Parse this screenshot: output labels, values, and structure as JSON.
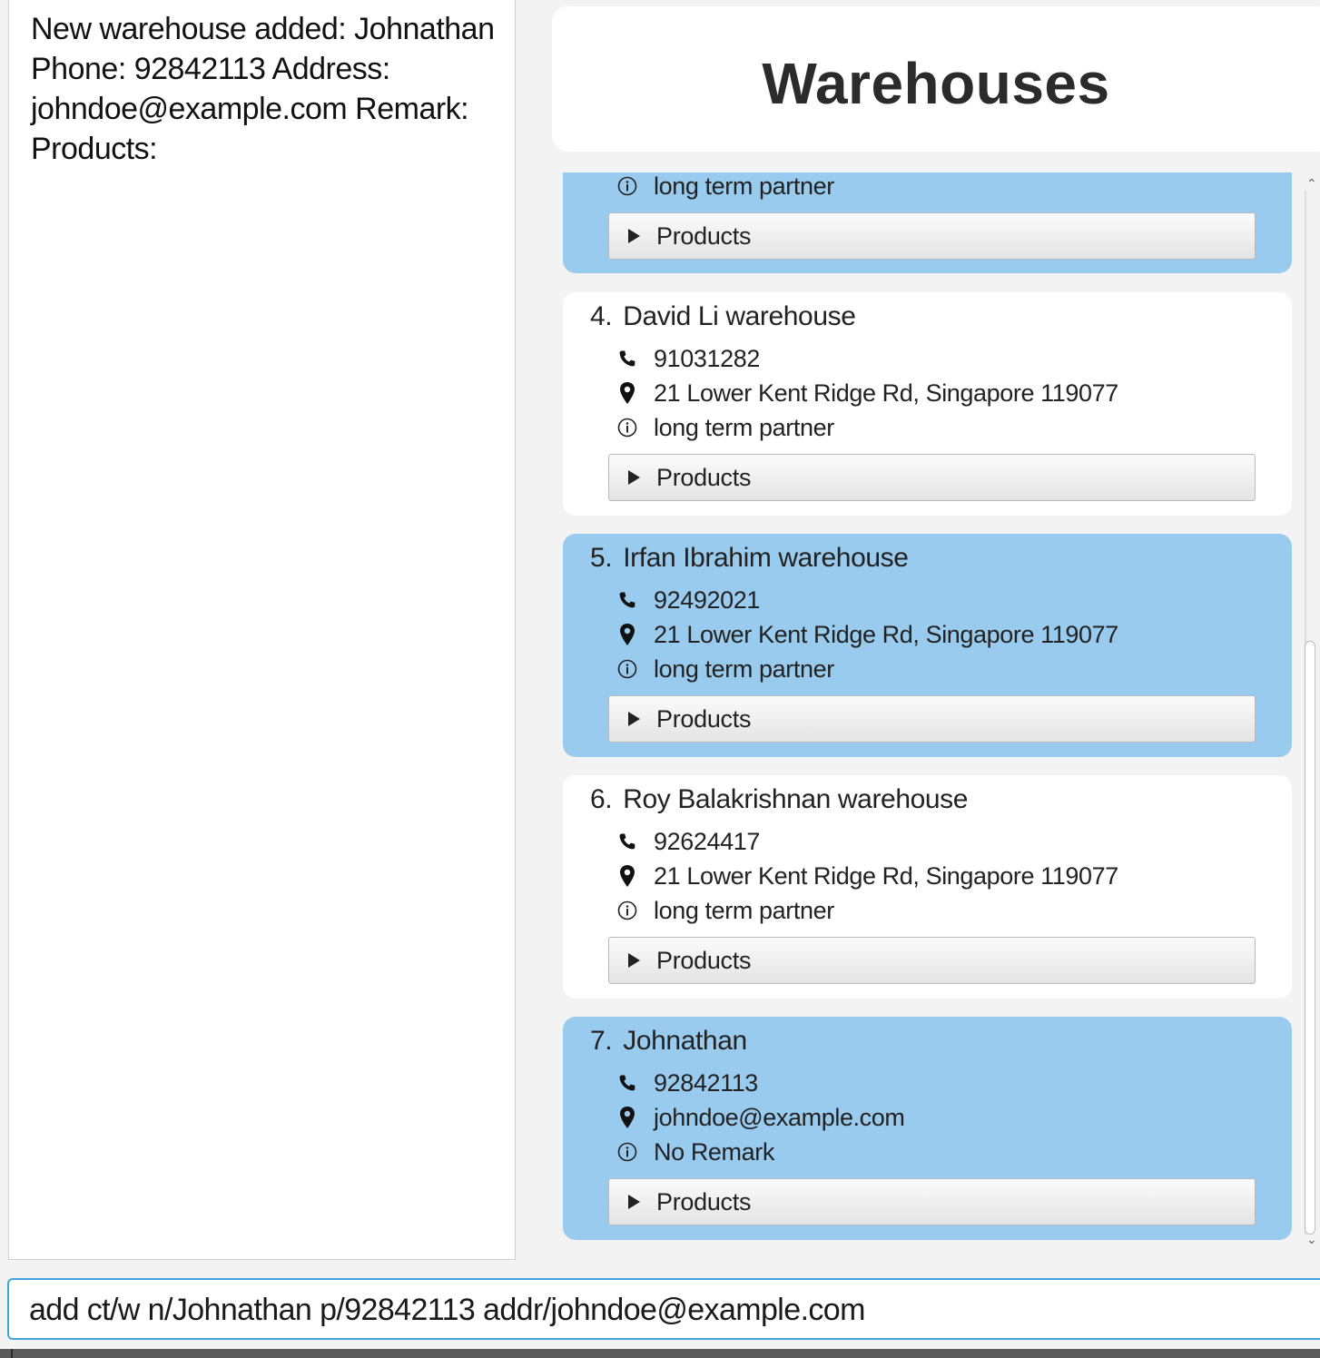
{
  "result_display": {
    "text": "New warehouse added: Johnathan Phone: 92842113 Address: johndoe@example.com Remark: Products:"
  },
  "header": {
    "title": "Warehouses"
  },
  "icons": {
    "phone": "phone-icon",
    "address": "location-pin-icon",
    "remark": "info-icon",
    "expand": "triangle-right-icon"
  },
  "colors": {
    "selected_card": "#99cbee",
    "card": "#ffffff",
    "input_focus_border": "#3ea6dd"
  },
  "warehouses": [
    {
      "remark": "long term partner",
      "products_label": "Products"
    },
    {
      "index": "4.",
      "name": "David Li warehouse",
      "phone": "91031282",
      "address": "21 Lower Kent Ridge Rd, Singapore 119077",
      "remark": "long term partner",
      "products_label": "Products"
    },
    {
      "index": "5.",
      "name": "Irfan Ibrahim warehouse",
      "phone": "92492021",
      "address": "21 Lower Kent Ridge Rd, Singapore 119077",
      "remark": "long term partner",
      "products_label": "Products"
    },
    {
      "index": "6.",
      "name": "Roy Balakrishnan warehouse",
      "phone": "92624417",
      "address": "21 Lower Kent Ridge Rd, Singapore 119077",
      "remark": "long term partner",
      "products_label": "Products"
    },
    {
      "index": "7.",
      "name": "Johnathan",
      "phone": "92842113",
      "address": "johndoe@example.com",
      "remark": "No Remark",
      "products_label": "Products"
    }
  ],
  "command": {
    "value": "add ct/w n/Johnathan p/92842113 addr/johndoe@example.com"
  }
}
